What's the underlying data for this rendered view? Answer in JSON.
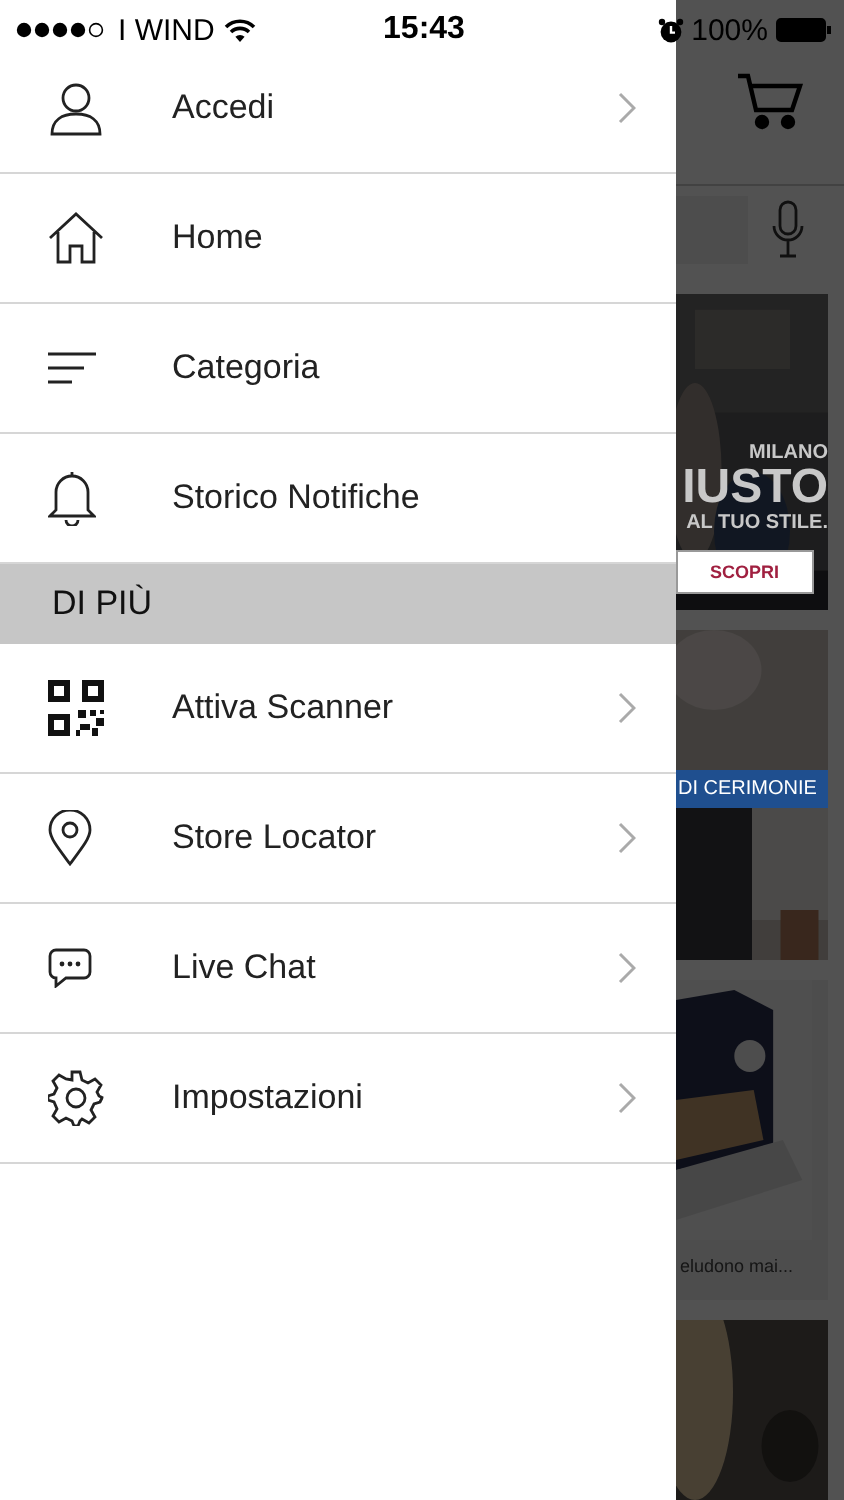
{
  "status_bar": {
    "carrier": "I WIND",
    "time": "15:43",
    "battery": "100%"
  },
  "menu": {
    "groups": [
      {
        "items": [
          {
            "label": "Accedi",
            "chevron": true
          },
          {
            "label": "Home",
            "chevron": false
          },
          {
            "label": "Categoria",
            "chevron": false
          },
          {
            "label": "Storico Notifiche",
            "chevron": false
          }
        ]
      },
      {
        "header": "DI PIÙ",
        "items": [
          {
            "label": "Attiva Scanner",
            "chevron": true
          },
          {
            "label": "Store Locator",
            "chevron": true
          },
          {
            "label": "Live Chat",
            "chevron": true
          },
          {
            "label": "Impostazioni",
            "chevron": true
          }
        ]
      }
    ]
  },
  "background_page": {
    "banner": {
      "subtitle": "MILANO",
      "title": "IUSTO",
      "tagline": "AL TUO STILE.",
      "button": "SCOPRI"
    },
    "promo": {
      "label": "DI CERIMONIE"
    },
    "product": {
      "caption": "eludono mai..."
    }
  }
}
